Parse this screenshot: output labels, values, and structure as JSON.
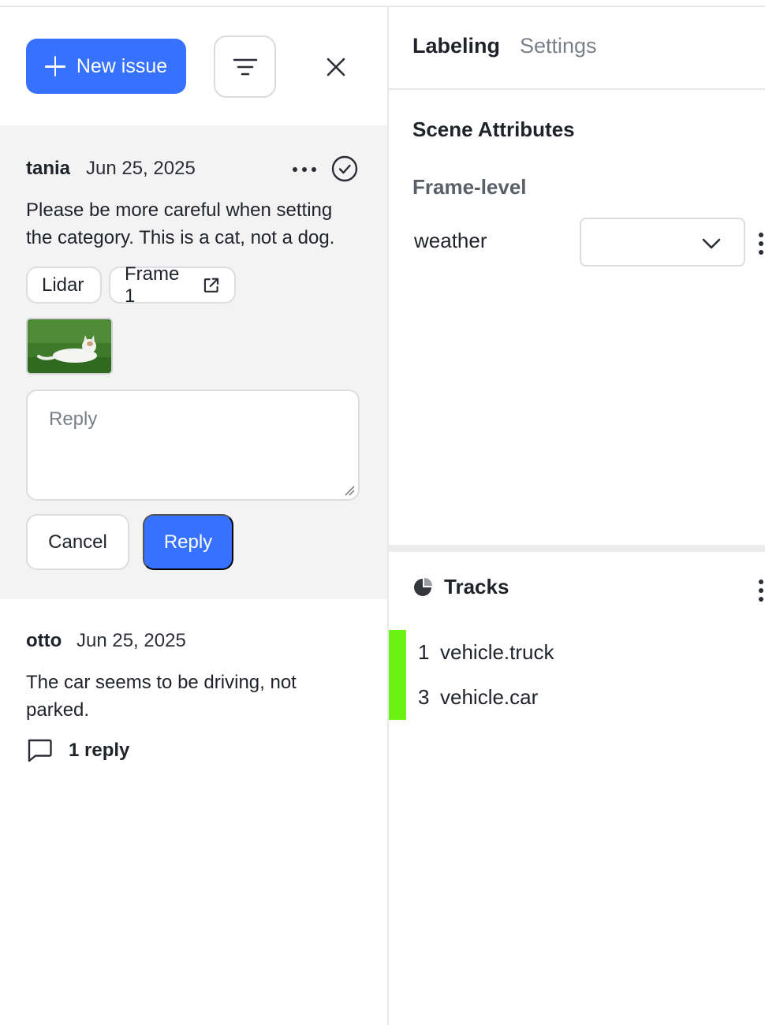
{
  "toolbar": {
    "new_issue_label": "New issue",
    "filter_icon": "filter-icon",
    "close_icon": "close-icon"
  },
  "issues": [
    {
      "author": "tania",
      "date": "Jun 25, 2025",
      "text_line1": "Please be more careful when setting",
      "text_line2": "the category. This is a cat, not a dog.",
      "chips": [
        "Lidar",
        "Frame 1"
      ],
      "reply_placeholder": "Reply",
      "cancel_label": "Cancel",
      "reply_label": "Reply"
    },
    {
      "author": "otto",
      "date": "Jun 25, 2025",
      "text_line1": "The car seems to be driving, not",
      "text_line2": "parked.",
      "reply_count": "1 reply"
    }
  ],
  "right": {
    "tabs": [
      {
        "label": "Labeling",
        "active": true
      },
      {
        "label": "Settings",
        "active": false
      }
    ],
    "scene_title": "Scene Attributes",
    "frame_level": "Frame-level",
    "attributes": [
      {
        "label": "weather",
        "value": ""
      }
    ],
    "tracks_title": "Tracks",
    "tracks": [
      {
        "id": "1",
        "name": "vehicle.truck",
        "color": "#6cf212"
      },
      {
        "id": "3",
        "name": "vehicle.car",
        "color": "#6cf212"
      }
    ]
  },
  "colors": {
    "accent": "#3672ff",
    "track": "#6cf212",
    "panel_bg": "#f3f3f4"
  }
}
